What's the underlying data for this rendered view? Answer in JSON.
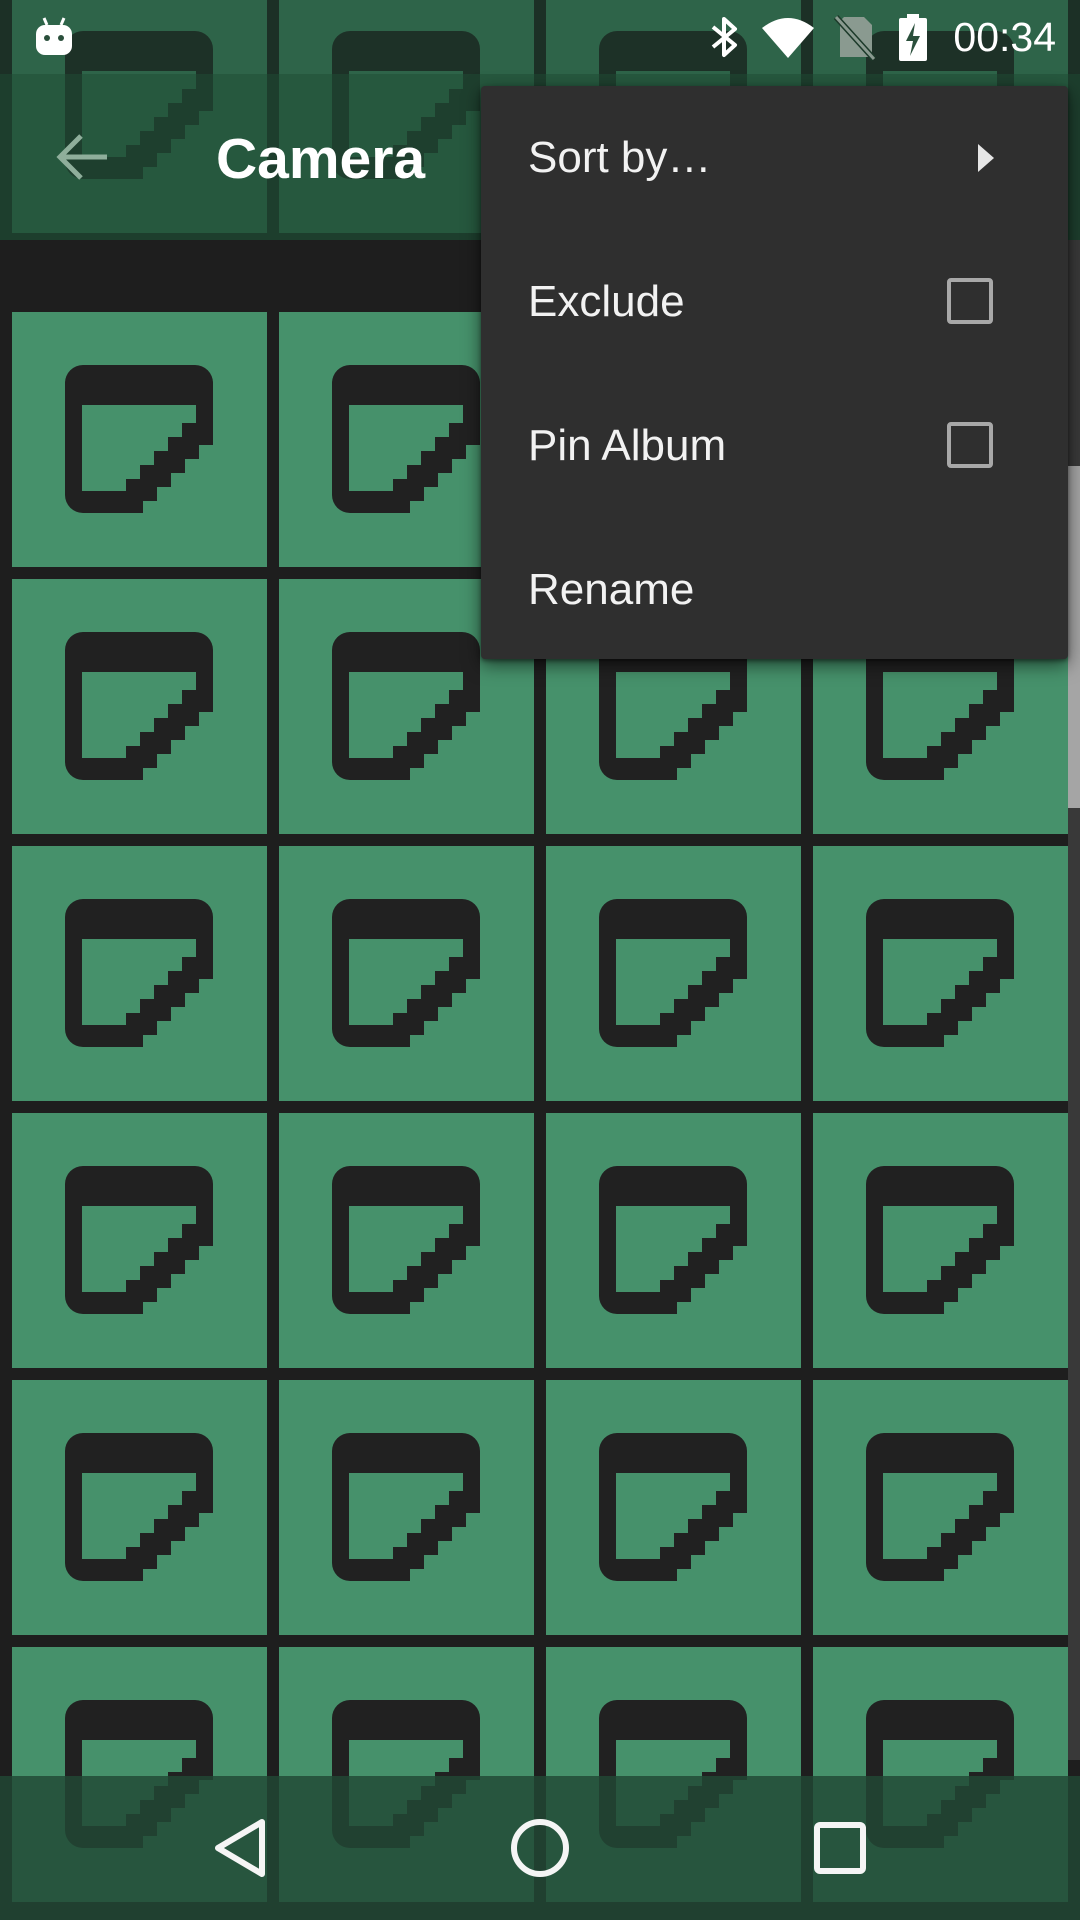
{
  "status_bar": {
    "time": "00:34",
    "icons": [
      "android-debug-icon",
      "bluetooth-icon",
      "wifi-icon",
      "no-sim-icon",
      "battery-charging-icon"
    ]
  },
  "toolbar": {
    "title": "Camera",
    "back_icon": "arrow-back-icon"
  },
  "grid": {
    "columns": 4,
    "tile_icon": "broken-image-icon",
    "tile_color": "#46916b"
  },
  "menu": {
    "sort_by": {
      "label": "Sort by…",
      "icon": "submenu-arrow-icon"
    },
    "exclude": {
      "label": "Exclude",
      "checked": false
    },
    "pin_album": {
      "label": "Pin Album",
      "checked": false
    },
    "rename": {
      "label": "Rename"
    }
  },
  "nav_bar": {
    "icons": [
      "back-triangle-icon",
      "home-circle-icon",
      "recents-square-icon"
    ]
  },
  "colors": {
    "accent": "#46916b",
    "menu_bg": "#2f2f2f",
    "toolbar_bg": "#1e4832"
  }
}
